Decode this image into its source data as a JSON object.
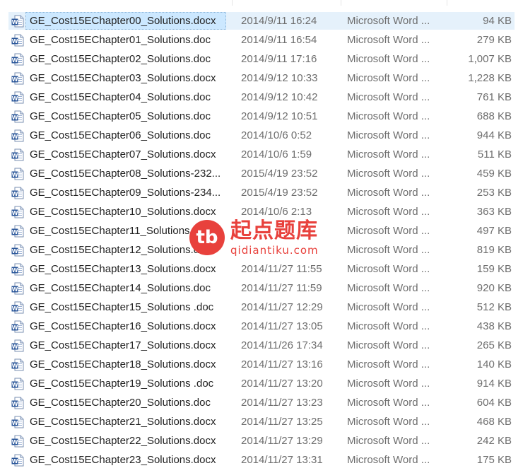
{
  "files": [
    {
      "name": "GE_Cost15EChapter00_Solutions.docx",
      "date": "2014/9/11 16:24",
      "type": "Microsoft Word ...",
      "size": "94 KB",
      "icon": "word-docx-icon",
      "selected": true
    },
    {
      "name": "GE_Cost15EChapter01_Solutions.doc",
      "date": "2014/9/11 16:54",
      "type": "Microsoft Word ...",
      "size": "279 KB",
      "icon": "word-doc-icon"
    },
    {
      "name": "GE_Cost15EChapter02_Solutions.doc",
      "date": "2014/9/11 17:16",
      "type": "Microsoft Word ...",
      "size": "1,007 KB",
      "icon": "word-doc-icon"
    },
    {
      "name": "GE_Cost15EChapter03_Solutions.docx",
      "date": "2014/9/12 10:33",
      "type": "Microsoft Word ...",
      "size": "1,228 KB",
      "icon": "word-docx-icon"
    },
    {
      "name": "GE_Cost15EChapter04_Solutions.doc",
      "date": "2014/9/12 10:42",
      "type": "Microsoft Word ...",
      "size": "761 KB",
      "icon": "word-doc-icon"
    },
    {
      "name": "GE_Cost15EChapter05_Solutions.doc",
      "date": "2014/9/12 10:51",
      "type": "Microsoft Word ...",
      "size": "688 KB",
      "icon": "word-doc-icon"
    },
    {
      "name": "GE_Cost15EChapter06_Solutions.doc",
      "date": "2014/10/6 0:52",
      "type": "Microsoft Word ...",
      "size": "944 KB",
      "icon": "word-doc-icon"
    },
    {
      "name": "GE_Cost15EChapter07_Solutions.docx",
      "date": "2014/10/6 1:59",
      "type": "Microsoft Word ...",
      "size": "511 KB",
      "icon": "word-docx-icon"
    },
    {
      "name": "GE_Cost15EChapter08_Solutions-232...",
      "date": "2015/4/19 23:52",
      "type": "Microsoft Word ...",
      "size": "459 KB",
      "icon": "word-doc-icon"
    },
    {
      "name": "GE_Cost15EChapter09_Solutions-234...",
      "date": "2015/4/19 23:52",
      "type": "Microsoft Word ...",
      "size": "253 KB",
      "icon": "word-doc-icon"
    },
    {
      "name": "GE_Cost15EChapter10_Solutions.docx",
      "date": "2014/10/6 2:13",
      "type": "Microsoft Word ...",
      "size": "363 KB",
      "icon": "word-docx-icon"
    },
    {
      "name": "GE_Cost15EChapter11_Solutions.doc",
      "date": "",
      "type": "Microsoft Word ...",
      "size": "497 KB",
      "icon": "word-doc-icon"
    },
    {
      "name": "GE_Cost15EChapter12_Solutions.doc",
      "date": "",
      "type": "Microsoft Word ...",
      "size": "819 KB",
      "icon": "word-doc-icon"
    },
    {
      "name": "GE_Cost15EChapter13_Solutions.docx",
      "date": "2014/11/27 11:55",
      "type": "Microsoft Word ...",
      "size": "159 KB",
      "icon": "word-docx-icon"
    },
    {
      "name": "GE_Cost15EChapter14_Solutions.doc",
      "date": "2014/11/27 11:59",
      "type": "Microsoft Word ...",
      "size": "920 KB",
      "icon": "word-doc-icon"
    },
    {
      "name": "GE_Cost15EChapter15_Solutions .doc",
      "date": "2014/11/27 12:29",
      "type": "Microsoft Word ...",
      "size": "512 KB",
      "icon": "word-doc-icon"
    },
    {
      "name": "GE_Cost15EChapter16_Solutions.docx",
      "date": "2014/11/27 13:05",
      "type": "Microsoft Word ...",
      "size": "438 KB",
      "icon": "word-docx-icon"
    },
    {
      "name": "GE_Cost15EChapter17_Solutions.docx",
      "date": "2014/11/26 17:34",
      "type": "Microsoft Word ...",
      "size": "265 KB",
      "icon": "word-docx-icon"
    },
    {
      "name": "GE_Cost15EChapter18_Solutions.docx",
      "date": "2014/11/27 13:16",
      "type": "Microsoft Word ...",
      "size": "140 KB",
      "icon": "word-docx-icon"
    },
    {
      "name": "GE_Cost15EChapter19_Solutions .doc",
      "date": "2014/11/27 13:20",
      "type": "Microsoft Word ...",
      "size": "914 KB",
      "icon": "word-doc-icon"
    },
    {
      "name": "GE_Cost15EChapter20_Solutions.doc",
      "date": "2014/11/27 13:23",
      "type": "Microsoft Word ...",
      "size": "604 KB",
      "icon": "word-doc-icon"
    },
    {
      "name": "GE_Cost15EChapter21_Solutions.docx",
      "date": "2014/11/27 13:25",
      "type": "Microsoft Word ...",
      "size": "468 KB",
      "icon": "word-docx-icon"
    },
    {
      "name": "GE_Cost15EChapter22_Solutions.docx",
      "date": "2014/11/27 13:29",
      "type": "Microsoft Word ...",
      "size": "242 KB",
      "icon": "word-docx-icon"
    },
    {
      "name": "GE_Cost15EChapter23_Solutions.docx",
      "date": "2014/11/27 13:31",
      "type": "Microsoft Word ...",
      "size": "175 KB",
      "icon": "word-docx-icon"
    }
  ],
  "watermark": {
    "badge": "tb",
    "chinese": "起点题库",
    "latin": "qidiantiku.com"
  },
  "colors": {
    "selection": "#cce8ff",
    "hover_row": "#e5f1fb",
    "word_blue": "#2b579a",
    "watermark_red": "#e8413c",
    "secondary_text": "#6d6d6d"
  }
}
